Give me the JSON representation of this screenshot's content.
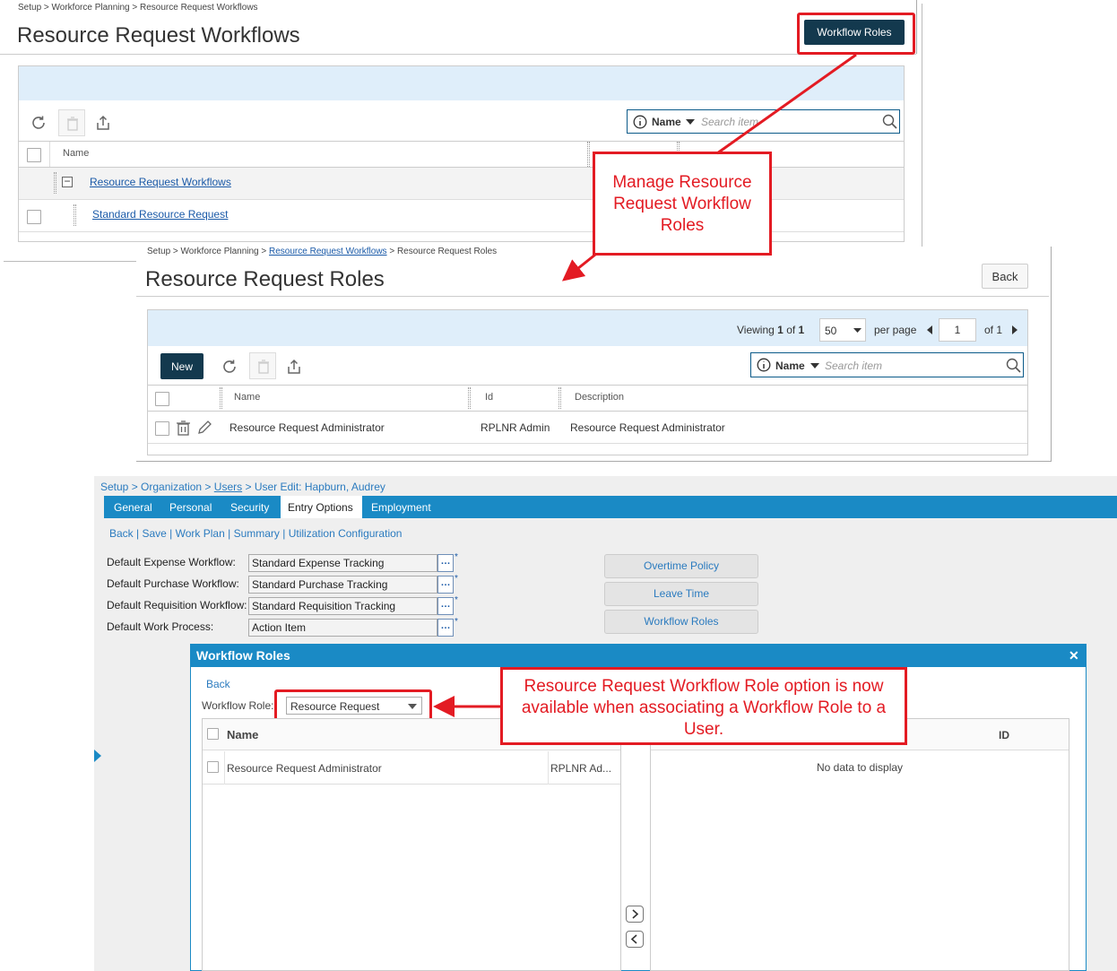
{
  "panel1": {
    "breadcrumb": "Setup > Workforce Planning > Resource Request Workflows",
    "title": "Resource Request Workflows",
    "workflow_roles_button": "Workflow Roles",
    "search": {
      "field": "Name",
      "placeholder": "Search item"
    },
    "columns": [
      "Name"
    ],
    "rows": [
      {
        "label": "Resource Request Workflows",
        "type": "group"
      },
      {
        "label": "Standard Resource Request",
        "type": "item"
      }
    ]
  },
  "panel2": {
    "breadcrumb_prefix": "Setup > Workforce Planning > ",
    "breadcrumb_link": "Resource Request Workflows",
    "breadcrumb_suffix": " > Resource Request Roles",
    "title": "Resource Request Roles",
    "back_button": "Back",
    "viewing_label": "Viewing",
    "viewing_current": "1",
    "viewing_of": "of",
    "viewing_total": "1",
    "per_page_value": "50",
    "per_page_label": "per page",
    "page_value": "1",
    "page_of": "of 1",
    "new_button": "New",
    "search": {
      "field": "Name",
      "placeholder": "Search item"
    },
    "columns": [
      "Name",
      "Id",
      "Description"
    ],
    "rows": [
      {
        "name": "Resource Request Administrator",
        "id": "RPLNR Admin",
        "description": "Resource Request Administrator"
      }
    ]
  },
  "panel3": {
    "breadcrumb": {
      "setup": "Setup",
      "org": "Organization",
      "users": "Users",
      "edit": "User Edit: Hapburn, Audrey"
    },
    "tabs": [
      "General",
      "Personal",
      "Security",
      "Entry Options",
      "Employment"
    ],
    "active_tab": "Entry Options",
    "actions": [
      "Back",
      "Save",
      "Work Plan",
      "Summary",
      "Utilization Configuration"
    ],
    "fields": [
      {
        "label": "Default Expense Workflow:",
        "value": "Standard Expense Tracking"
      },
      {
        "label": "Default Purchase Workflow:",
        "value": "Standard Purchase Tracking"
      },
      {
        "label": "Default Requisition Workflow:",
        "value": "Standard Requisition Tracking"
      },
      {
        "label": "Default Work Process:",
        "value": "Action Item"
      }
    ],
    "side_buttons": [
      "Overtime Policy",
      "Leave Time",
      "Workflow Roles"
    ],
    "modal": {
      "title": "Workflow Roles",
      "back": "Back",
      "role_label": "Workflow Role:",
      "role_value": "Resource Request",
      "left_columns": [
        "Name"
      ],
      "left_rows": [
        {
          "name": "Resource Request Administrator",
          "id": "RPLNR Ad..."
        }
      ],
      "right_columns": [
        "ID"
      ],
      "right_empty": "No data to display"
    }
  },
  "callouts": {
    "manage": "Manage Resource Request Workflow Roles",
    "available": "Resource Request Workflow Role option is now available when associating a Workflow Role to a User."
  }
}
